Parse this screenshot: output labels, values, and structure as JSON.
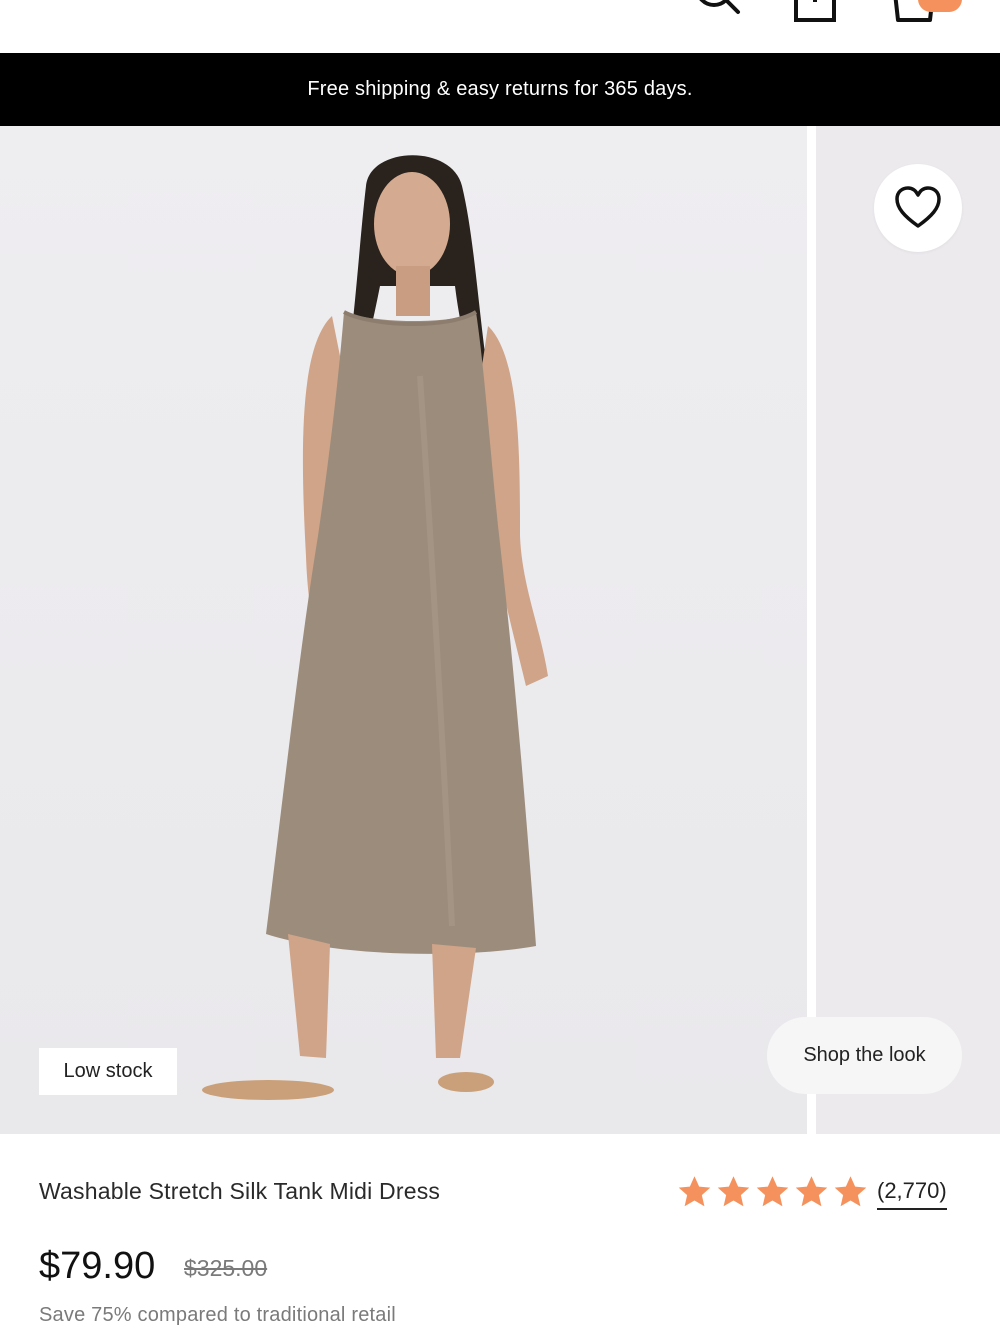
{
  "header": {
    "back_icon": "arrow-left-icon",
    "search_icon": "search-icon",
    "share_icon": "share-icon",
    "bag_icon": "shopping-bag-icon",
    "badge_color": "#f4915c"
  },
  "promo_banner": {
    "text": "Free shipping & easy returns for 365 days."
  },
  "gallery": {
    "favorite_icon": "heart-icon",
    "low_stock_label": "Low stock",
    "shop_the_look_label": "Shop the look",
    "dress_color": "#9c8c7c"
  },
  "product": {
    "title": "Washable Stretch Silk Tank Midi Dress",
    "rating": 5,
    "rating_max": 5,
    "review_count": "(2,770)",
    "price": "$79.90",
    "original_price": "$325.00",
    "savings_text": "Save 75% compared to traditional retail",
    "star_color": "#f4915c"
  }
}
